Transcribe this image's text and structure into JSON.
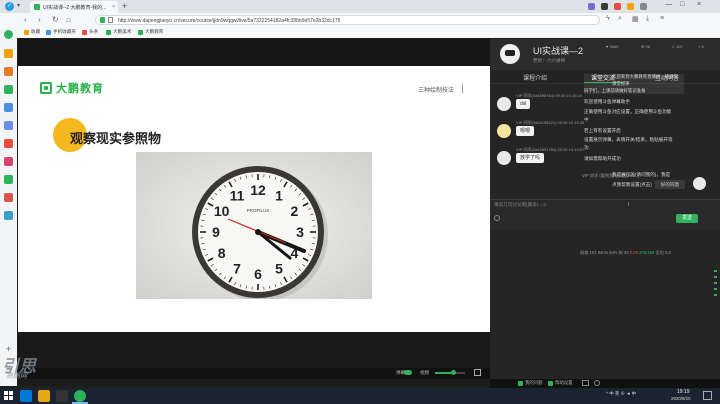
{
  "colors": {
    "accent": "#2fb25c",
    "brand_green": "#27b14b",
    "highlight_yellow": "#f5b820",
    "alert_red": "#e84c3d"
  },
  "browser": {
    "tab_title": "UI实战课--2 大鹏教育-我的...",
    "tab_close": "×",
    "new_tab": "+",
    "url": "http://www.dapengjiaoyu.cn/secure/course/jjdn9wqqwl/live/5a7322254182a4fc39bb9e57e2b32dc175",
    "window_controls": [
      "—",
      "□",
      "×"
    ],
    "bookmarks": [
      "收藏",
      "手机收藏夹",
      "头条",
      "大鹏美术",
      "大鹏教育"
    ]
  },
  "slide": {
    "logo_text": "大鹏教育",
    "header_right": "三种绘制技法",
    "title": "观察现实参照物",
    "clock_numbers": [
      "12",
      "1",
      "2",
      "3",
      "4",
      "5",
      "6",
      "7",
      "8",
      "9",
      "10",
      "11"
    ],
    "clock_brand": "PROFILUS"
  },
  "player": {
    "switch_label": "弹幕",
    "volume_label": "视频",
    "volume_level": 0.55
  },
  "watermark": {
    "line1": "引思",
    "line2": "高鹏网"
  },
  "chat": {
    "course_title": "UI实战课—2",
    "teacher": "老师：六六讲师",
    "stats": [
      {
        "icon": "like-icon",
        "value": "3069"
      },
      {
        "icon": "chat-icon",
        "value": "36"
      },
      {
        "icon": "user-icon",
        "value": "107"
      },
      {
        "icon": "gift-icon",
        "value": "5"
      }
    ],
    "tabs": [
      "课程介绍",
      "课堂交流",
      "互动问答"
    ],
    "active_tab": 1,
    "notices": [
      "欢迎来到大鹏教育直播间，请遵守",
      "课堂纪律",
      "同学们，上课前请做好笔记准备"
    ],
    "messages": [
      {
        "name": "VIP 同学(2a4598784)",
        "time": "09:30 10:15:24",
        "text": "dsl"
      },
      {
        "name": "VIP 同学(2a54195421)",
        "time": "09:30 10:15:35",
        "text": "嗯嗯"
      },
      {
        "name": "VIP 同学(2a45891784)",
        "time": "09:30 10:15:57",
        "text": "放学了吗"
      }
    ],
    "system_lines": [
      "欢迎使用斗鱼弹幕助手",
      "正确使用斗鱼对应设置，正确使用斗鱼功能",
      "中",
      "若上有有设置开启",
      "设置展示弹幕，表情开关/结果，粘贴展开等",
      "功",
      "请如需帮助开成功"
    ],
    "reply": {
      "name": "VIP 同学 (看到我的问题(2a5...)",
      "lines": [
        "我是展示的(请问我的)，我是",
        "点我帮我设置(点击)"
      ],
      "bubble": "好的同意"
    },
    "input_placeholder": "来说几句讨论吧(最多) ...0",
    "send_label": "发送",
    "network": {
      "prefix": "网络 101 94ms",
      "mid": "64% 帧 30",
      "speed": "0.05",
      "stat": "375/196",
      "tail": "丢包 0.0"
    },
    "bottom_buttons": [
      "我的问题",
      "帮助设置"
    ]
  },
  "taskbar": {
    "tray": "^ 中 英 ⊕ ◄ 中",
    "time": "19:19",
    "date": "2020/9/20"
  }
}
